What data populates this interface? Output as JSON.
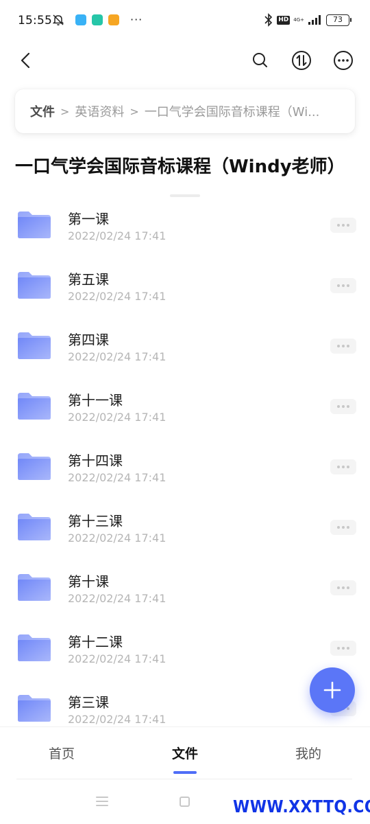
{
  "status_bar": {
    "time": "15:55",
    "more_indicator": "···",
    "hd_label": "HD",
    "network_label": "4G+",
    "battery": "73",
    "icons": [
      "mute-icon",
      "app-notification-icon",
      "video-app-icon",
      "reading-app-icon",
      "bluetooth-icon",
      "signal-icon"
    ]
  },
  "nav": {
    "icons": [
      "back-icon",
      "search-icon",
      "sort-icon",
      "more-icon"
    ]
  },
  "breadcrumb": {
    "root": "文件",
    "separator": ">",
    "parent": "英语资料",
    "current": "一口气学会国际音标课程（Wi..."
  },
  "folder_title": "一口气学会国际音标课程（Windy老师）",
  "files": [
    {
      "name": "第一课",
      "date": "2022/02/24 17:41"
    },
    {
      "name": "第五课",
      "date": "2022/02/24 17:41"
    },
    {
      "name": "第四课",
      "date": "2022/02/24 17:41"
    },
    {
      "name": "第十一课",
      "date": "2022/02/24 17:41"
    },
    {
      "name": "第十四课",
      "date": "2022/02/24 17:41"
    },
    {
      "name": "第十三课",
      "date": "2022/02/24 17:41"
    },
    {
      "name": "第十课",
      "date": "2022/02/24 17:41"
    },
    {
      "name": "第十二课",
      "date": "2022/02/24 17:41"
    },
    {
      "name": "第三课",
      "date": "2022/02/24 17:41"
    }
  ],
  "tabs": [
    {
      "label": "首页",
      "active": false
    },
    {
      "label": "文件",
      "active": true
    },
    {
      "label": "我的",
      "active": false
    }
  ],
  "watermark": "WWW.XXTTQ.COM",
  "colors": {
    "accent": "#5b76f7",
    "folder_light": "#a9b7fb",
    "folder_dark": "#7188f8",
    "watermark": "#1034e6"
  }
}
